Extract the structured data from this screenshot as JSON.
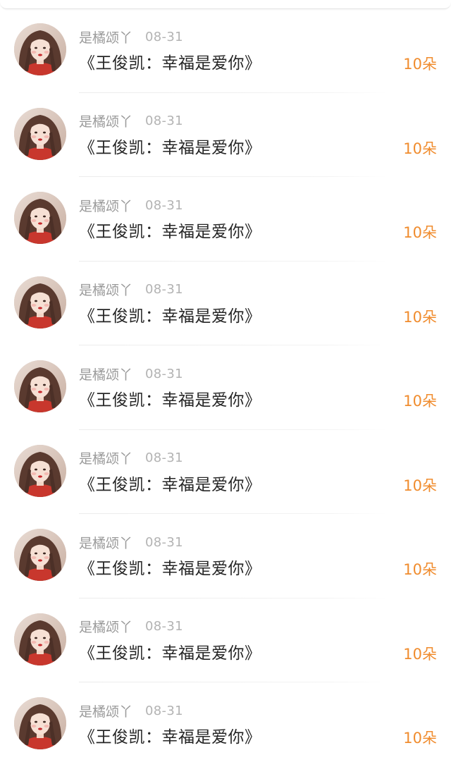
{
  "items": [
    {
      "username": "是橘颂丫",
      "date": "08-31",
      "title": "《王俊凯：幸福是爱你》",
      "count": "10朵"
    },
    {
      "username": "是橘颂丫",
      "date": "08-31",
      "title": "《王俊凯：幸福是爱你》",
      "count": "10朵"
    },
    {
      "username": "是橘颂丫",
      "date": "08-31",
      "title": "《王俊凯：幸福是爱你》",
      "count": "10朵"
    },
    {
      "username": "是橘颂丫",
      "date": "08-31",
      "title": "《王俊凯：幸福是爱你》",
      "count": "10朵"
    },
    {
      "username": "是橘颂丫",
      "date": "08-31",
      "title": "《王俊凯：幸福是爱你》",
      "count": "10朵"
    },
    {
      "username": "是橘颂丫",
      "date": "08-31",
      "title": "《王俊凯：幸福是爱你》",
      "count": "10朵"
    },
    {
      "username": "是橘颂丫",
      "date": "08-31",
      "title": "《王俊凯：幸福是爱你》",
      "count": "10朵"
    },
    {
      "username": "是橘颂丫",
      "date": "08-31",
      "title": "《王俊凯：幸福是爱你》",
      "count": "10朵"
    },
    {
      "username": "是橘颂丫",
      "date": "08-31",
      "title": "《王俊凯：幸福是爱你》",
      "count": "10朵"
    }
  ],
  "colors": {
    "count_accent": "#f08c2e",
    "username": "#9a9a9a",
    "date": "#b3b3b3",
    "title": "#262626"
  },
  "icons": {
    "avatar": "profile-photo"
  }
}
